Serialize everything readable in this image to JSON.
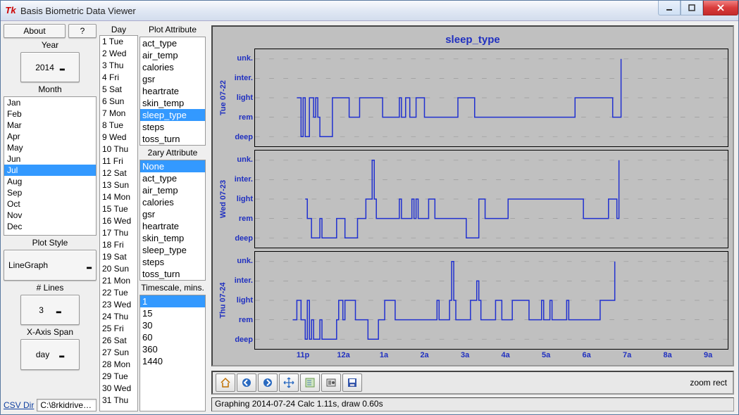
{
  "window": {
    "title": "Basis Biometric Data Viewer"
  },
  "header": {
    "about": "About",
    "help": "?"
  },
  "year": {
    "label": "Year",
    "value": "2014"
  },
  "month": {
    "label": "Month",
    "items": [
      "Jan",
      "Feb",
      "Mar",
      "Apr",
      "May",
      "Jun",
      "Jul",
      "Aug",
      "Sep",
      "Oct",
      "Nov",
      "Dec"
    ],
    "selected": "Jul"
  },
  "plotstyle": {
    "label": "Plot Style",
    "value": "LineGraph"
  },
  "nlines": {
    "label": "# Lines",
    "value": "3"
  },
  "xspan": {
    "label": "X-Axis Span",
    "value": "day"
  },
  "csv": {
    "link": "CSV Dir",
    "path": "C:\\8rkidrives..."
  },
  "day": {
    "label": "Day",
    "items": [
      "1 Tue",
      "2 Wed",
      "3 Thu",
      "4 Fri",
      "5 Sat",
      "6 Sun",
      "7 Mon",
      "8 Tue",
      "9 Wed",
      "10 Thu",
      "11 Fri",
      "12 Sat",
      "13 Sun",
      "14 Mon",
      "15 Tue",
      "16 Wed",
      "17 Thu",
      "18 Fri",
      "19 Sat",
      "20 Sun",
      "21 Mon",
      "22 Tue",
      "23 Wed",
      "24 Thu",
      "25 Fri",
      "26 Sat",
      "27 Sun",
      "28 Mon",
      "29 Tue",
      "30 Wed",
      "31 Thu"
    ],
    "selected": "22 Tue"
  },
  "plot_attr": {
    "label": "Plot Attribute",
    "items": [
      "act_type",
      "air_temp",
      "calories",
      "gsr",
      "heartrate",
      "skin_temp",
      "sleep_type",
      "steps",
      "toss_turn"
    ],
    "selected": "sleep_type"
  },
  "sec_attr": {
    "label": "2ary Attribute",
    "items": [
      "None",
      "act_type",
      "air_temp",
      "calories",
      "gsr",
      "heartrate",
      "skin_temp",
      "sleep_type",
      "steps",
      "toss_turn"
    ],
    "selected": "None"
  },
  "timescale": {
    "label": "Timescale, mins.",
    "items": [
      "1",
      "15",
      "30",
      "60",
      "360",
      "1440"
    ],
    "selected": "1"
  },
  "plot": {
    "title": "sleep_type",
    "y_categories": [
      "unk.",
      "inter.",
      "light",
      "rem",
      "deep"
    ],
    "x_labels": [
      "11p",
      "12a",
      "1a",
      "2a",
      "3a",
      "4a",
      "5a",
      "6a",
      "7a",
      "8a",
      "9a"
    ],
    "rows": [
      {
        "label": "Tue 07-22"
      },
      {
        "label": "Wed 07-23"
      },
      {
        "label": "Thu 07-24"
      }
    ]
  },
  "chart_data": {
    "type": "line",
    "ylabel": "sleep_type",
    "y_categories": [
      "unk.",
      "inter.",
      "light",
      "rem",
      "deep"
    ],
    "x_start_hour": 22.2,
    "x_end_hour": 33.5,
    "x_ticks": [
      "11p",
      "12a",
      "1a",
      "2a",
      "3a",
      "4a",
      "5a",
      "6a",
      "7a",
      "8a",
      "9a"
    ],
    "series": [
      {
        "name": "Tue 07-22",
        "points": [
          [
            23.2,
            "light"
          ],
          [
            23.3,
            "deep"
          ],
          [
            23.35,
            "light"
          ],
          [
            23.4,
            "deep"
          ],
          [
            23.5,
            "light"
          ],
          [
            23.6,
            "rem"
          ],
          [
            23.65,
            "light"
          ],
          [
            23.7,
            "rem"
          ],
          [
            23.75,
            "deep"
          ],
          [
            24.0,
            "deep"
          ],
          [
            24.05,
            "light"
          ],
          [
            24.4,
            "light"
          ],
          [
            24.45,
            "rem"
          ],
          [
            24.6,
            "rem"
          ],
          [
            24.7,
            "light"
          ],
          [
            25.2,
            "light"
          ],
          [
            25.25,
            "rem"
          ],
          [
            25.6,
            "rem"
          ],
          [
            25.65,
            "light"
          ],
          [
            25.7,
            "rem"
          ],
          [
            25.8,
            "light"
          ],
          [
            25.9,
            "rem"
          ],
          [
            26.0,
            "rem"
          ],
          [
            26.05,
            "light"
          ],
          [
            26.2,
            "light"
          ],
          [
            26.25,
            "rem"
          ],
          [
            27.0,
            "rem"
          ],
          [
            27.05,
            "light"
          ],
          [
            27.4,
            "light"
          ],
          [
            27.45,
            "rem"
          ],
          [
            29.8,
            "rem"
          ],
          [
            29.85,
            "light"
          ],
          [
            30.7,
            "light"
          ],
          [
            30.75,
            "rem"
          ],
          [
            30.95,
            "rem"
          ],
          [
            30.95,
            "unk."
          ]
        ]
      },
      {
        "name": "Wed 07-23",
        "points": [
          [
            23.4,
            "light"
          ],
          [
            23.45,
            "rem"
          ],
          [
            23.55,
            "rem"
          ],
          [
            23.55,
            "deep"
          ],
          [
            23.7,
            "deep"
          ],
          [
            23.75,
            "rem"
          ],
          [
            23.8,
            "deep"
          ],
          [
            24.1,
            "deep"
          ],
          [
            24.15,
            "rem"
          ],
          [
            24.3,
            "rem"
          ],
          [
            24.35,
            "deep"
          ],
          [
            24.6,
            "deep"
          ],
          [
            24.65,
            "rem"
          ],
          [
            24.8,
            "rem"
          ],
          [
            24.85,
            "light"
          ],
          [
            24.95,
            "light"
          ],
          [
            25.0,
            "unk."
          ],
          [
            25.05,
            "light"
          ],
          [
            25.1,
            "rem"
          ],
          [
            25.6,
            "rem"
          ],
          [
            25.65,
            "light"
          ],
          [
            25.7,
            "rem"
          ],
          [
            25.9,
            "rem"
          ],
          [
            25.95,
            "light"
          ],
          [
            26.0,
            "rem"
          ],
          [
            26.05,
            "light"
          ],
          [
            26.1,
            "rem"
          ],
          [
            26.3,
            "rem"
          ],
          [
            26.35,
            "light"
          ],
          [
            26.45,
            "light"
          ],
          [
            26.5,
            "rem"
          ],
          [
            27.2,
            "rem"
          ],
          [
            27.25,
            "deep"
          ],
          [
            27.5,
            "deep"
          ],
          [
            27.55,
            "light"
          ],
          [
            27.65,
            "light"
          ],
          [
            27.7,
            "rem"
          ],
          [
            28.2,
            "rem"
          ],
          [
            28.25,
            "light"
          ],
          [
            30.0,
            "light"
          ],
          [
            30.05,
            "rem"
          ],
          [
            30.6,
            "rem"
          ],
          [
            30.65,
            "light"
          ],
          [
            30.8,
            "light"
          ],
          [
            30.85,
            "rem"
          ],
          [
            30.9,
            "rem"
          ],
          [
            30.9,
            "unk."
          ]
        ]
      },
      {
        "name": "Thu 07-24",
        "points": [
          [
            23.1,
            "rem"
          ],
          [
            23.2,
            "light"
          ],
          [
            23.3,
            "rem"
          ],
          [
            23.4,
            "deep"
          ],
          [
            23.45,
            "light"
          ],
          [
            23.5,
            "deep"
          ],
          [
            23.55,
            "rem"
          ],
          [
            23.6,
            "deep"
          ],
          [
            23.7,
            "deep"
          ],
          [
            23.75,
            "rem"
          ],
          [
            23.8,
            "deep"
          ],
          [
            24.1,
            "deep"
          ],
          [
            24.15,
            "rem"
          ],
          [
            24.2,
            "light"
          ],
          [
            24.3,
            "rem"
          ],
          [
            24.35,
            "light"
          ],
          [
            24.55,
            "light"
          ],
          [
            24.6,
            "rem"
          ],
          [
            24.85,
            "rem"
          ],
          [
            24.9,
            "deep"
          ],
          [
            25.1,
            "deep"
          ],
          [
            25.15,
            "rem"
          ],
          [
            25.25,
            "rem"
          ],
          [
            25.3,
            "light"
          ],
          [
            25.5,
            "light"
          ],
          [
            25.55,
            "rem"
          ],
          [
            26.5,
            "rem"
          ],
          [
            26.55,
            "light"
          ],
          [
            26.6,
            "rem"
          ],
          [
            26.8,
            "rem"
          ],
          [
            26.85,
            "light"
          ],
          [
            26.9,
            "unk."
          ],
          [
            26.95,
            "light"
          ],
          [
            27.0,
            "rem"
          ],
          [
            27.3,
            "rem"
          ],
          [
            27.35,
            "light"
          ],
          [
            27.45,
            "light"
          ],
          [
            27.5,
            "inter."
          ],
          [
            27.55,
            "light"
          ],
          [
            27.6,
            "rem"
          ],
          [
            27.9,
            "rem"
          ],
          [
            27.95,
            "light"
          ],
          [
            28.05,
            "light"
          ],
          [
            28.1,
            "rem"
          ],
          [
            28.3,
            "rem"
          ],
          [
            28.35,
            "light"
          ],
          [
            28.7,
            "light"
          ],
          [
            28.75,
            "rem"
          ],
          [
            29.0,
            "rem"
          ],
          [
            29.05,
            "light"
          ],
          [
            29.1,
            "rem"
          ],
          [
            29.2,
            "rem"
          ],
          [
            29.25,
            "light"
          ],
          [
            29.3,
            "rem"
          ],
          [
            29.6,
            "rem"
          ],
          [
            29.65,
            "light"
          ],
          [
            29.7,
            "rem"
          ],
          [
            30.4,
            "rem"
          ],
          [
            30.45,
            "light"
          ],
          [
            30.8,
            "light"
          ],
          [
            30.8,
            "unk."
          ]
        ]
      }
    ]
  },
  "toolbar": {
    "zoom_mode": "zoom rect"
  },
  "status": {
    "text": "Graphing 2014-07-24 Calc 1.11s, draw 0.60s"
  }
}
